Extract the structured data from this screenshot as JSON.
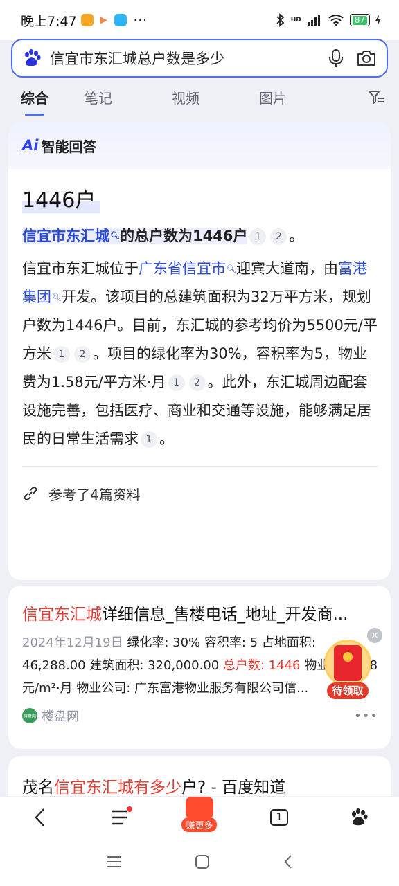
{
  "status": {
    "time": "晚上7:47",
    "dots": "···",
    "hd": "HD",
    "battery": "87"
  },
  "search": {
    "query": "信宜市东汇城总户数是多少"
  },
  "tabs": [
    "综合",
    "笔记",
    "视频",
    "图片"
  ],
  "ai_answer": {
    "logo": "Ai",
    "title": "智能回答",
    "headline": "1446户",
    "summary_link": "信宜市东汇城",
    "summary_text": "的总户数为1446户",
    "summary_end": "。",
    "p1": "信宜市东汇城位于",
    "p1_link": "广东省信宜市",
    "p2": "迎宾大道南，由",
    "p2_link": "富港集团",
    "p3": "开发。该项目的总建筑面积为32万平方米，规划户数为1446户。目前，东汇城的参考均价为5500元/平方米",
    "p4": "。项目的绿化率为30%，容积率为5，物业费为1.58元/平方米·月",
    "p5": "。此外，东汇城周边配套设施完善，包括医疗、商业和交通等设施，能够满足居民的日常生活需求",
    "p6": "。",
    "cite1": "1",
    "cite2": "2",
    "refs": "参考了4篇资料"
  },
  "result1": {
    "title_red": "信宜东汇城",
    "title_rest": "详细信息_售楼电话_地址_开发商...",
    "date": "2024年12月19日",
    "text1": " 绿化率: 30% 容积率: 5 占地面积: 46,288.00 建筑面积: 320,000.00 ",
    "text_red": "总户数: 1446",
    "text2": " 物业费: 1.58元/m²·月 物业公司: 广东富港物业服务有限公司信...",
    "source": "楼盘网",
    "source_icon": "楼盘网",
    "more": "•••"
  },
  "packet": {
    "label": "待领取",
    "close": "×"
  },
  "result2": {
    "pre": "茂名",
    "red": "信宜东汇城有多少",
    "post": "户? - 百度知道"
  },
  "bottom": {
    "earn": "赚更多",
    "tab_count": "1"
  }
}
